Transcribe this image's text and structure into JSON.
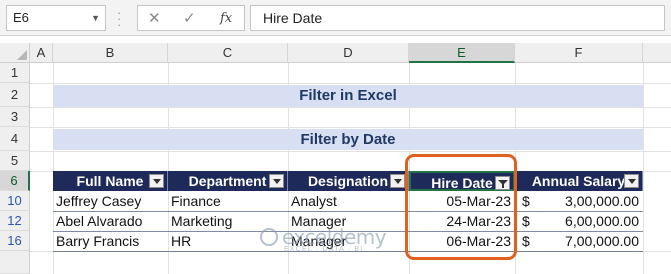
{
  "formula_bar": {
    "name_box": "E6",
    "cancel_glyph": "✕",
    "enter_glyph": "✓",
    "fx_label": "fx",
    "value": "Hire Date"
  },
  "columns": [
    "A",
    "B",
    "C",
    "D",
    "E",
    "F"
  ],
  "rows": [
    "1",
    "2",
    "3",
    "4",
    "5",
    "6",
    "10",
    "12",
    "16"
  ],
  "selected_cell": "E6",
  "title": "Filter in Excel",
  "subtitle": "Filter by Date",
  "table": {
    "headers": [
      "Full Name",
      "Department",
      "Designation",
      "Hire Date",
      "Annual Salary"
    ],
    "rows": [
      {
        "name": "Jeffrey Casey",
        "department": "Finance",
        "designation": "Analyst",
        "hire_date": "05-Mar-23",
        "currency": "$",
        "salary": "3,00,000.00"
      },
      {
        "name": "Abel Alvarado",
        "department": "Marketing",
        "designation": "Manager",
        "hire_date": "24-Mar-23",
        "currency": "$",
        "salary": "6,00,000.00"
      },
      {
        "name": "Barry Francis",
        "department": "HR",
        "designation": "Manager",
        "hire_date": "06-Mar-23",
        "currency": "$",
        "salary": "7,00,000.00"
      }
    ]
  },
  "watermark": {
    "name": "exceldemy",
    "tagline": "EXCEL · DATA · BI"
  },
  "colors": {
    "header_bg": "#1e2a5a",
    "banner_bg": "#d9dff2",
    "highlight": "#e2611f",
    "selection": "#217346"
  }
}
